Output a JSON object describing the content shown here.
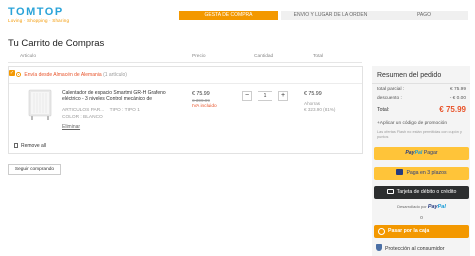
{
  "brand": {
    "name": "TOMTOP",
    "tagline": "Loving · Shopping · Sharing",
    "accent": "#f39800",
    "logo_color": "#2aa3d8"
  },
  "steps": [
    {
      "label": "GESTA DE COMPRA",
      "active": true
    },
    {
      "label": "ENVIO Y LUGAR DE LA ORDEN",
      "active": false
    },
    {
      "label": "PAGO",
      "active": false
    }
  ],
  "page_title": "Tu Carrito de Compras",
  "columns": {
    "article": "Articulo",
    "price": "Precio",
    "quantity": "Cantidad",
    "total": "Total"
  },
  "shipping": {
    "label": "Envía desde Almacén de Alemania",
    "count": "(1 artículo)"
  },
  "item": {
    "name": "Calentador de espacio Smartmi GR-H Grafeno eléctrico - 3 niveles Control mecánico de",
    "attr_articles": "ARTICULOS PAR...",
    "attr_type": "TIPO : TIPO 1",
    "attr_color": "COLOR : BLANCO",
    "remove": "Eliminar",
    "price": "€ 75.99",
    "old_price": "€ 399.99",
    "tax_note": "IVA incluido",
    "quantity": "1",
    "total": "€ 75.99",
    "save_label": "Ahorras",
    "save_value": "€ 323.90 (81%)"
  },
  "remove_all": "Remove all",
  "continue_shopping": "Seguir comprando",
  "summary": {
    "title": "Resumen del pedido",
    "subtotal_label": "total parcial :",
    "subtotal_value": "€ 75.99",
    "discount_label": "descuento :",
    "discount_value": "- € 0.00",
    "total_label": "Total:",
    "total_value": "€ 75.99",
    "promo": "+Aplicar un código de promoción",
    "note": "Las ofertas Flash no están permitidas con cupón y puntos",
    "paypal_text": "Pagar",
    "paypal_brand_a": "Pay",
    "paypal_brand_b": "Pal",
    "installments": "Paga en 3 plazos",
    "card": "Tarjeta de débito o crédito",
    "powered_by": "Desarrollado por",
    "or": "o",
    "checkout": "Pasar por la caja",
    "protection": "Protección al consumidor"
  }
}
